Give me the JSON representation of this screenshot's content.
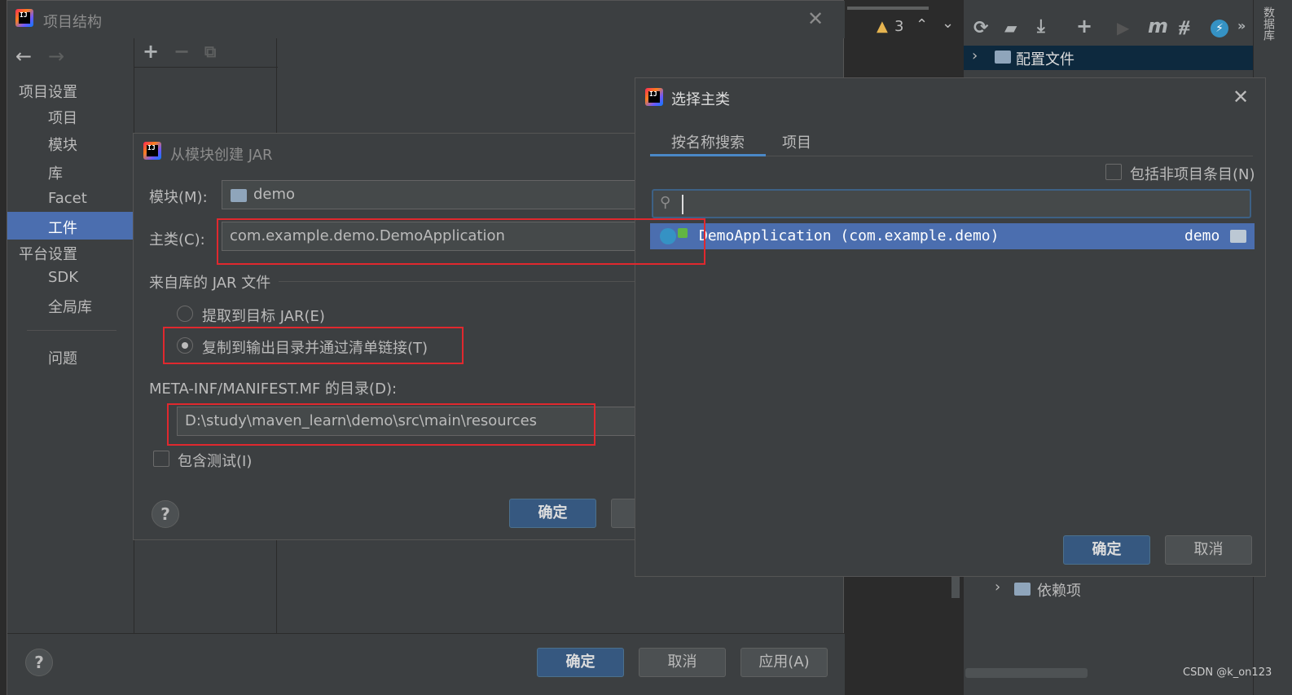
{
  "project_structure": {
    "title": "项目结构",
    "nav": {
      "project_settings": "项目设置",
      "items_project": [
        "项目",
        "模块",
        "库",
        "Facet",
        "工件"
      ],
      "platform_settings": "平台设置",
      "items_platform": [
        "SDK",
        "全局库"
      ],
      "problems": "问题",
      "selected": "工件"
    },
    "ok": "确定",
    "cancel": "取消",
    "apply": "应用(A)"
  },
  "jar_dialog": {
    "title": "从模块创建 JAR",
    "module_label": "模块(M):",
    "module_value": "demo",
    "main_class_label": "主类(C):",
    "main_class_value": "com.example.demo.DemoApplication",
    "jar_files_section": "来自库的 JAR 文件",
    "radio_extract": "提取到目标 JAR(E)",
    "radio_copy": "复制到输出目录并通过清单链接(T)",
    "manifest_label": "META-INF/MANIFEST.MF 的目录(D):",
    "manifest_value": "D:\\study\\maven_learn\\demo\\src\\main\\resources",
    "include_tests": "包含测试(I)",
    "ok": "确定"
  },
  "main_class_dialog": {
    "title": "选择主类",
    "tabs": [
      "按名称搜索",
      "项目"
    ],
    "active_tab": "按名称搜索",
    "include_non_project": "包括非项目条目(N)",
    "search_value": "",
    "result_name": "DemoApplication (com.example.demo)",
    "result_module": "demo",
    "ok": "确定",
    "cancel": "取消"
  },
  "background_ide": {
    "warning_count": "3",
    "maven_tree_item_1": "配置文件",
    "maven_tree_item_2": "依赖项",
    "side_tab": "数据库",
    "watermark": "CSDN @k_on123"
  },
  "colors": {
    "selection": "#4b6eaf",
    "primary_button": "#365880",
    "red_highlight": "#e0282e",
    "dialog_bg": "#3c3f41"
  }
}
